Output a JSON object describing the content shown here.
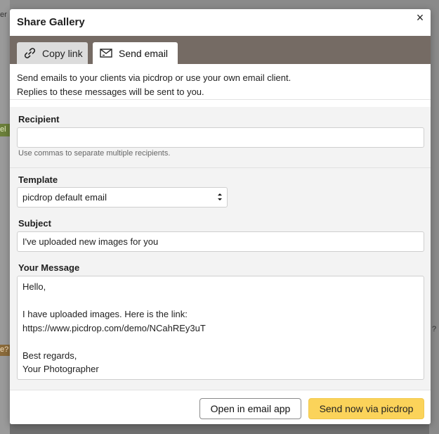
{
  "background": {
    "fragments": [
      "er",
      "el",
      "e?",
      "?"
    ]
  },
  "modal": {
    "title": "Share Gallery",
    "close_label": "×"
  },
  "tabs": [
    {
      "label": "Copy link",
      "icon": "link-icon",
      "active": false
    },
    {
      "label": "Send email",
      "icon": "envelope-icon",
      "active": true
    }
  ],
  "intro": {
    "line1": "Send emails to your clients via picdrop or use your own email client.",
    "line2": "Replies to these messages will be sent to you."
  },
  "recipient": {
    "label": "Recipient",
    "value": "",
    "hint": "Use commas to separate multiple recipients."
  },
  "template": {
    "label": "Template",
    "selected": "picdrop default email"
  },
  "subject": {
    "label": "Subject",
    "value": "I've uploaded new images for you"
  },
  "message": {
    "label": "Your Message",
    "value": "Hello,\n\nI have uploaded images. Here is the link:\nhttps://www.picdrop.com/demo/NCahREy3uT\n\nBest regards,\nYour Photographer"
  },
  "footer": {
    "open_label": "Open in email app",
    "send_label": "Send now via picdrop"
  },
  "colors": {
    "accent": "#fbd35a",
    "tabbar": "#756b64"
  }
}
